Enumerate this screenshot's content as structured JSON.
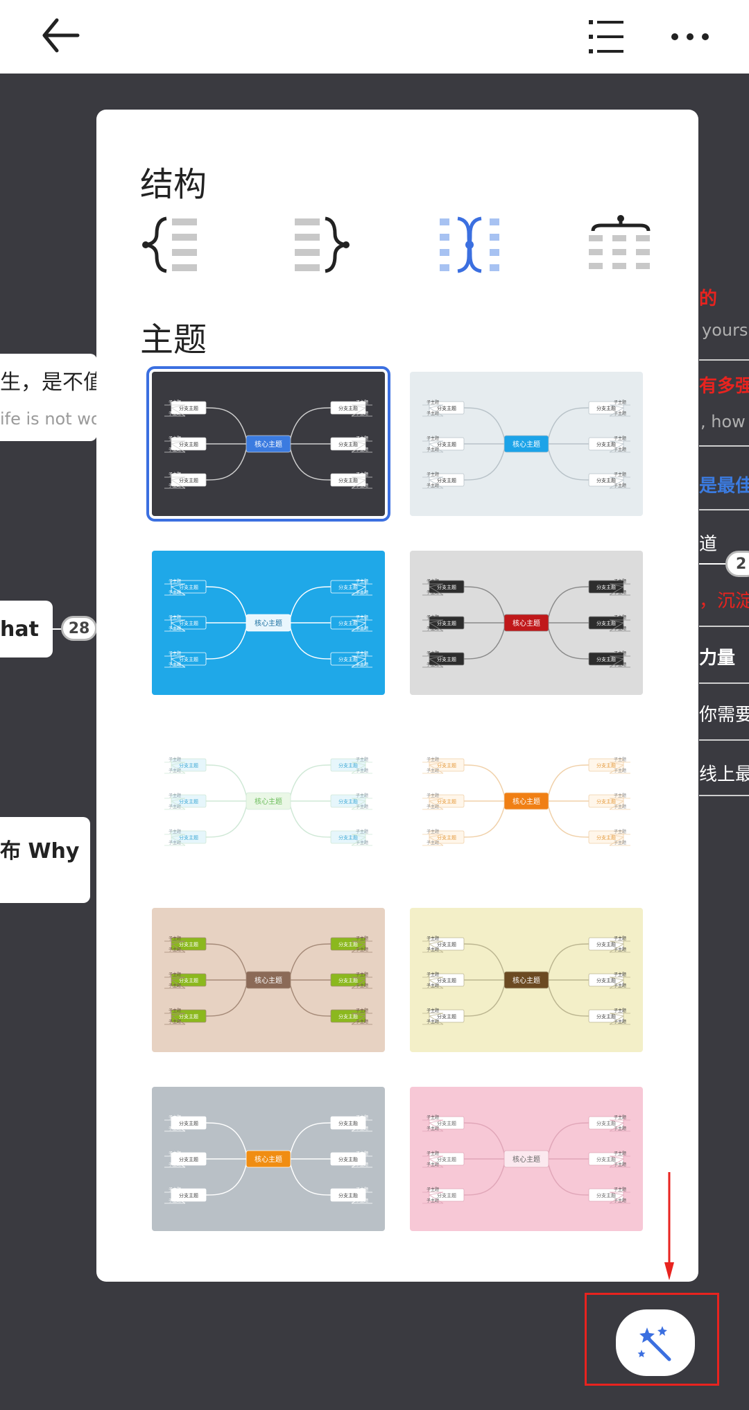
{
  "topbar": {
    "back_icon": "back-arrow-icon",
    "outline_icon": "list-outline-icon",
    "more_icon": "more-dots-icon"
  },
  "background": {
    "left_fragments": [
      {
        "text": "生，是不值"
      },
      {
        "text": "ife is not wor"
      },
      {
        "text": "hat"
      },
      {
        "text": "布 Why"
      }
    ],
    "badges": {
      "left": "28",
      "right": "2"
    },
    "right_fragments": [
      {
        "text": "的",
        "color": "#e8231f"
      },
      {
        "text": "yours.",
        "color": "#b0b0b0"
      },
      {
        "text": "有多强",
        "color": "#e8231f"
      },
      {
        "text": ", how s",
        "color": "#b0b0b0"
      },
      {
        "text": "是最佳",
        "color": "#3b7be0"
      },
      {
        "text": "道",
        "color": "#ffffff"
      },
      {
        "text": "，沉淀",
        "color": "#e8231f"
      },
      {
        "text": "力量",
        "color": "#ffffff"
      },
      {
        "text": "你需要",
        "color": "#ffffff"
      },
      {
        "text": "线上最",
        "color": "#ffffff"
      }
    ]
  },
  "panel": {
    "structure_title": "结构",
    "theme_title": "主题",
    "structures": [
      {
        "name": "left-structure-icon",
        "selected": false
      },
      {
        "name": "right-structure-icon",
        "selected": false
      },
      {
        "name": "both-sides-structure-icon",
        "selected": true
      },
      {
        "name": "org-chart-structure-icon",
        "selected": false
      }
    ],
    "theme_labels": {
      "core": "核心主题",
      "branch": "分支主题",
      "sub": "子主题"
    },
    "themes": [
      {
        "id": "dark",
        "bg": "#3a3a40",
        "core": "#3b7be0",
        "core_text": "#ffffff",
        "branch_bg": "#ffffff",
        "branch_text": "#333333",
        "line": "#cfcfcf",
        "sub_text": "#ffffff",
        "selected": true
      },
      {
        "id": "light-gray",
        "bg": "#e6ecef",
        "core": "#1ca3e8",
        "core_text": "#ffffff",
        "branch_bg": "#ffffff",
        "branch_text": "#333333",
        "line": "#b8c2c8",
        "sub_text": "#555555",
        "selected": false
      },
      {
        "id": "sky-blue",
        "bg": "#1fa8e8",
        "core": "#e9f6fd",
        "core_text": "#1a6fa0",
        "branch_bg": "#1fa8e8",
        "branch_text": "#ffffff",
        "line": "#ffffff",
        "sub_text": "#ffffff",
        "selected": false
      },
      {
        "id": "gray-red",
        "bg": "#dcdcdc",
        "core": "#c0181a",
        "core_text": "#ffffff",
        "branch_bg": "#2d2d2d",
        "branch_text": "#ffffff",
        "line": "#8a8a8a",
        "sub_text": "#333333",
        "selected": false
      },
      {
        "id": "mint-outline",
        "bg": "#ffffff",
        "core": "#eaf7e6",
        "core_text": "#6bbd5a",
        "branch_bg": "#e6f6fb",
        "branch_text": "#3aa7d6",
        "line": "#cfe8d6",
        "sub_text": "#8a9aa6",
        "selected": false
      },
      {
        "id": "orange-outline",
        "bg": "#ffffff",
        "core": "#f07f14",
        "core_text": "#ffffff",
        "branch_bg": "#fff6ea",
        "branch_text": "#e59a3a",
        "line": "#f0d0a8",
        "sub_text": "#8a8a8a",
        "selected": false
      },
      {
        "id": "tan-green",
        "bg": "#e7d2c2",
        "core": "#8b6a57",
        "core_text": "#ffffff",
        "branch_bg": "#8bb81e",
        "branch_text": "#ffffff",
        "line": "#a58a78",
        "sub_text": "#6b5444",
        "selected": false
      },
      {
        "id": "cream-brown",
        "bg": "#f3efc8",
        "core": "#6b4a22",
        "core_text": "#ffffff",
        "branch_bg": "#ffffff",
        "branch_text": "#444444",
        "line": "#bbb590",
        "sub_text": "#444444",
        "selected": false
      },
      {
        "id": "slate-orange",
        "bg": "#b9c0c6",
        "core": "#f08d12",
        "core_text": "#ffffff",
        "branch_bg": "#ffffff",
        "branch_text": "#444444",
        "line": "#ffffff",
        "sub_text": "#ffffff",
        "selected": false
      },
      {
        "id": "pink",
        "bg": "#f7c8d6",
        "core": "#fbe9ef",
        "core_text": "#666666",
        "branch_bg": "#ffffff",
        "branch_text": "#666666",
        "line": "#e0a6b8",
        "sub_text": "#555555",
        "selected": false
      }
    ]
  },
  "fab": {
    "icon": "magic-wand-icon"
  }
}
